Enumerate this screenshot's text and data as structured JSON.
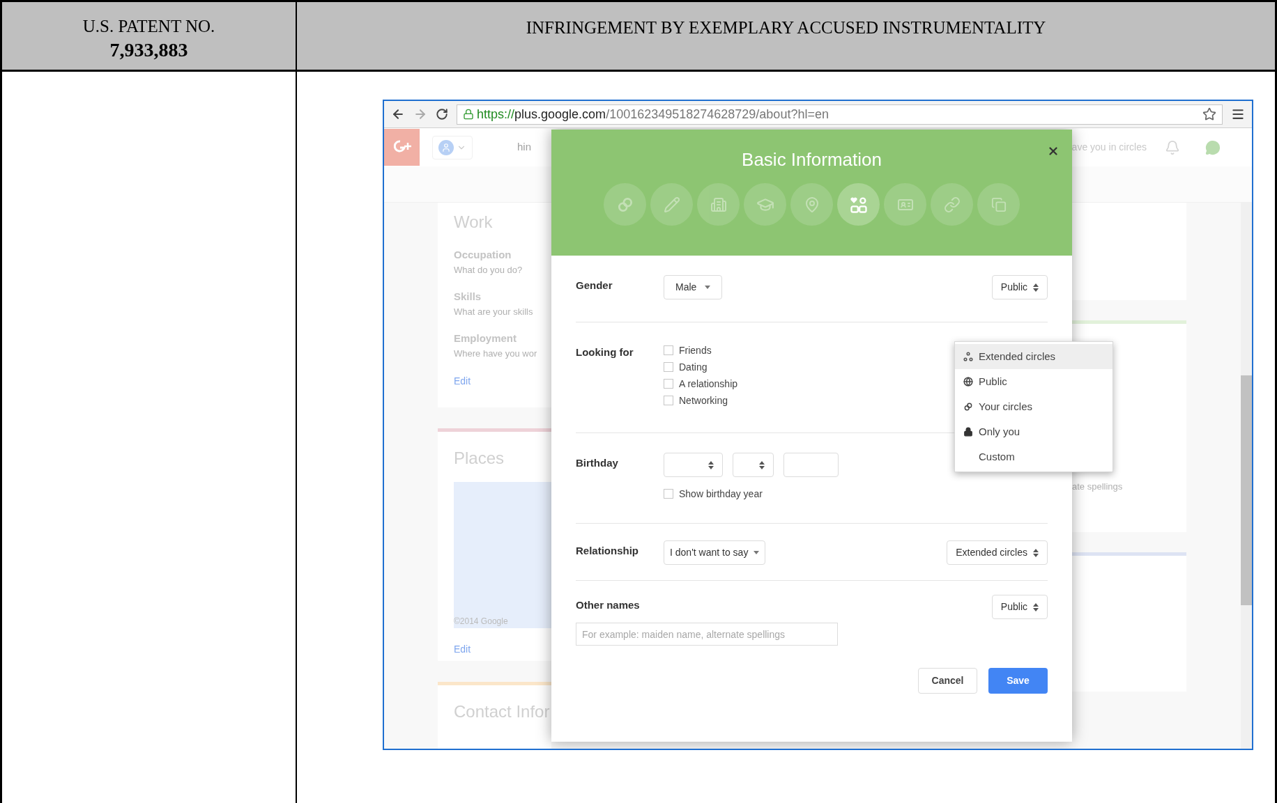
{
  "document_table": {
    "header": {
      "patent_label": "U.S. PATENT NO.",
      "patent_number": "7,933,883",
      "column_2": "INFRINGEMENT BY EXEMPLARY ACCUSED INSTRUMENTALITY"
    }
  },
  "browser": {
    "url_scheme": "https://",
    "url_host": "plus.google.com",
    "url_path": "/100162349518274628729/about?hl=en"
  },
  "background_page": {
    "top_bar": {
      "search_fragment": "hin",
      "circles_fragment": "ave you in circles"
    },
    "work_card": {
      "title": "Work",
      "fields": [
        {
          "label": "Occupation",
          "hint": "What do you do?"
        },
        {
          "label": "Skills",
          "hint": "What are your skills"
        },
        {
          "label": "Employment",
          "hint": "Where have you wor"
        }
      ],
      "edit": "Edit"
    },
    "places_card": {
      "title": "Places",
      "map_credit": "©2014 Google",
      "edit": "Edit"
    },
    "contact_card": {
      "title": "Contact Infor"
    },
    "right_card_fragment": "ate spellings"
  },
  "dialog": {
    "title": "Basic Information",
    "tabs": [
      {
        "selected": false
      },
      {
        "selected": false
      },
      {
        "selected": false
      },
      {
        "selected": false
      },
      {
        "selected": false
      },
      {
        "selected": true
      },
      {
        "selected": false
      },
      {
        "selected": false
      },
      {
        "selected": false
      }
    ],
    "gender": {
      "label": "Gender",
      "value": "Male",
      "visibility": "Public"
    },
    "looking_for": {
      "label": "Looking for",
      "options": [
        {
          "label": "Friends",
          "checked": false
        },
        {
          "label": "Dating",
          "checked": false
        },
        {
          "label": "A relationship",
          "checked": false
        },
        {
          "label": "Networking",
          "checked": false
        }
      ]
    },
    "birthday": {
      "label": "Birthday",
      "show_year": {
        "label": "Show birthday year",
        "checked": false
      }
    },
    "relationship": {
      "label": "Relationship",
      "value": "I don't want to say",
      "visibility": "Extended circles"
    },
    "other_names": {
      "label": "Other names",
      "visibility": "Public",
      "placeholder": "For example: maiden name, alternate spellings"
    },
    "buttons": [
      {
        "label": "Cancel",
        "kind": "secondary"
      },
      {
        "label": "Save",
        "kind": "primary"
      }
    ]
  },
  "visibility_menu": {
    "items": [
      {
        "label": "Extended circles",
        "selected": true
      },
      {
        "label": "Public",
        "selected": false
      },
      {
        "label": "Your circles",
        "selected": false
      },
      {
        "label": "Only you",
        "selected": false
      },
      {
        "label": "Custom",
        "selected": false
      }
    ]
  }
}
